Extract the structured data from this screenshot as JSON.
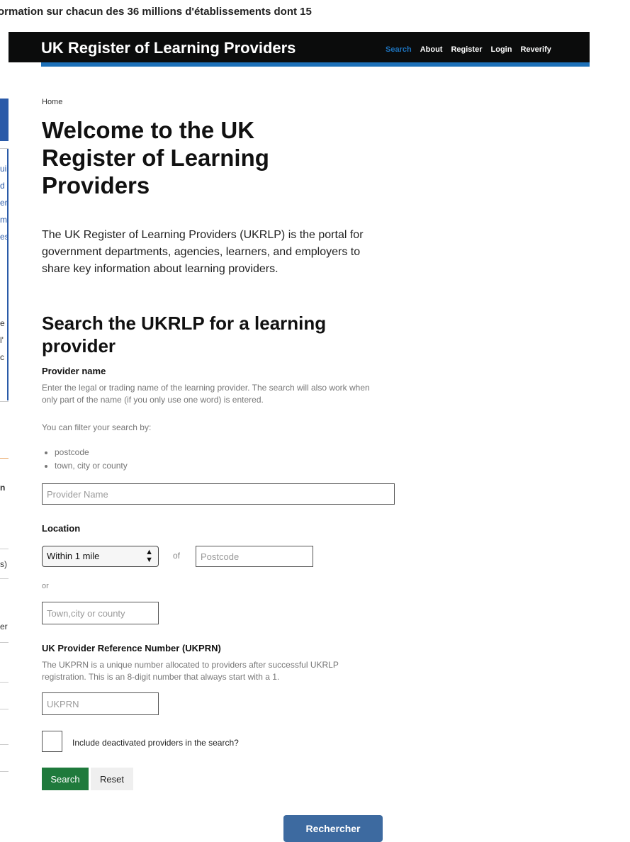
{
  "background_banner": "ormation sur chacun des 36 millions d'établissements dont 15",
  "background_fragments": [
    "ui",
    "d",
    "er",
    "m",
    "es",
    "e",
    "l'",
    "c",
    "n",
    "s)",
    "er"
  ],
  "site": {
    "title": "UK Register of Learning Providers",
    "nav": [
      "Search",
      "About",
      "Register",
      "Login",
      "Reverify"
    ],
    "active_nav": "Search"
  },
  "breadcrumb": "Home",
  "heading": "Welcome to the UK Register of Learning Providers",
  "intro": "The UK Register of Learning Providers (UKRLP) is the portal for government departments, agencies, learners, and employers to share key information about learning providers.",
  "search_heading": "Search the UKRLP for a learning provider",
  "provider_name": {
    "label": "Provider name",
    "hint": "Enter the legal or trading name of the learning provider. The search will also work when only part of the name (if you only use one word) is entered.",
    "filter_text": "You can filter your search by:",
    "filters": [
      "postcode",
      "town, city or county"
    ],
    "placeholder": "Provider Name"
  },
  "location": {
    "label": "Location",
    "distance_selected": "Within 1 mile",
    "of_text": "of",
    "postcode_placeholder": "Postcode",
    "or_text": "or",
    "town_placeholder": "Town,city or county"
  },
  "ukprn": {
    "label": "UK Provider Reference Number (UKPRN)",
    "hint": "The UKPRN is a unique number allocated to providers after successful UKRLP registration. This is an 8-digit number that always start with a 1.",
    "placeholder": "UKPRN"
  },
  "include_deactivated": {
    "label": "Include deactivated providers in the search?",
    "checked": false
  },
  "buttons": {
    "search": "Search",
    "reset": "Reset",
    "rechercher": "Rechercher"
  },
  "colors": {
    "header_bg": "#0b0c0c",
    "accent_blue": "#1d70b8",
    "search_green": "#1f7a3c",
    "rechercher_blue": "#3d6aa0"
  }
}
